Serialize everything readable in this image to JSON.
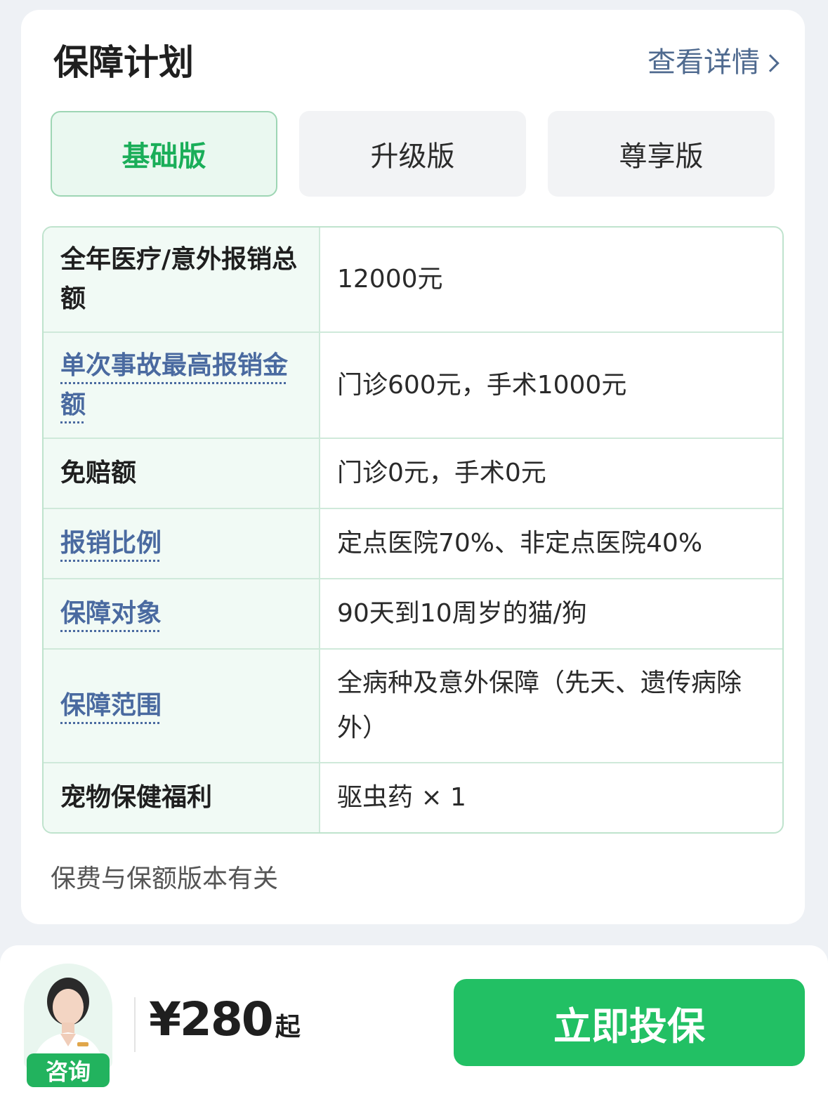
{
  "plan": {
    "title": "保障计划",
    "detail_link": "查看详情",
    "tabs": [
      {
        "label": "基础版",
        "active": true
      },
      {
        "label": "升级版",
        "active": false
      },
      {
        "label": "尊享版",
        "active": false
      }
    ],
    "rows": [
      {
        "label": "全年医疗/意外报销总额",
        "value": "12000元",
        "link": false
      },
      {
        "label": "单次事故最高报销金额",
        "value": "门诊600元，手术1000元",
        "link": true
      },
      {
        "label": "免赔额",
        "value": "门诊0元，手术0元",
        "link": false
      },
      {
        "label": "报销比例",
        "value": "定点医院70%、非定点医院40%",
        "link": true
      },
      {
        "label": "保障对象",
        "value": "90天到10周岁的猫/狗",
        "link": true
      },
      {
        "label": "保障范围",
        "value": "全病种及意外保障（先天、遗传病除外）",
        "link": true
      },
      {
        "label": "宠物保健福利",
        "value": "驱虫药 × 1",
        "link": false
      }
    ],
    "note": "保费与保额版本有关"
  },
  "footer": {
    "consult_label": "咨询",
    "price": "¥280",
    "price_suffix": "起",
    "buy_label": "立即投保"
  },
  "colors": {
    "accent_green": "#22c064",
    "link_blue": "#4a6aa0"
  }
}
